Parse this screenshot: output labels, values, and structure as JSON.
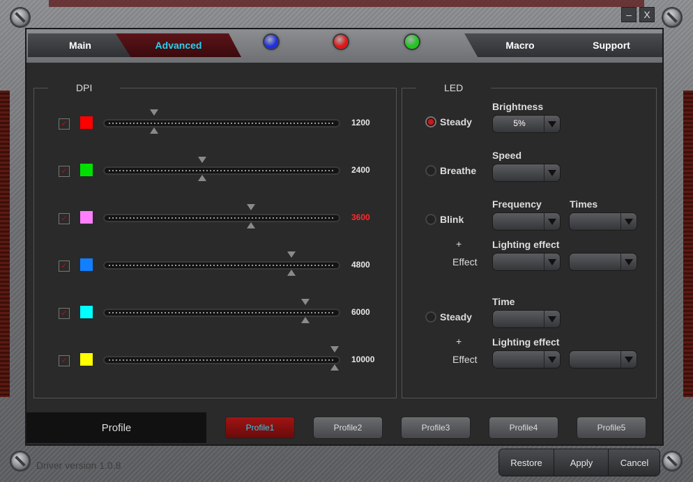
{
  "tabs": {
    "main": "Main",
    "advanced": "Advanced",
    "macro": "Macro",
    "support": "Support"
  },
  "window": {
    "minimize": "–",
    "close": "X"
  },
  "indicators": [
    {
      "color": "#1e2fe0"
    },
    {
      "color": "#e01616"
    },
    {
      "color": "#1ec81e"
    }
  ],
  "dpi": {
    "legend": "DPI",
    "rows": [
      {
        "checked": true,
        "color": "#ff0000",
        "value": "1200",
        "fraction": 0.2,
        "value_color": "#e8e8e8"
      },
      {
        "checked": true,
        "color": "#00e000",
        "value": "2400",
        "fraction": 0.415,
        "value_color": "#e8e8e8"
      },
      {
        "checked": true,
        "color": "#ff80ff",
        "value": "3600",
        "fraction": 0.63,
        "value_color": "#ff2a2a"
      },
      {
        "checked": true,
        "color": "#1080ff",
        "value": "4800",
        "fraction": 0.81,
        "value_color": "#e8e8e8"
      },
      {
        "checked": true,
        "color": "#00ffff",
        "value": "6000",
        "fraction": 0.87,
        "value_color": "#e8e8e8"
      },
      {
        "checked": true,
        "color": "#ffff00",
        "value": "10000",
        "fraction": 1.0,
        "value_color": "#e8e8e8"
      }
    ]
  },
  "led": {
    "legend": "LED",
    "steady": {
      "label": "Steady",
      "selected": true,
      "brightness_label": "Brightness",
      "brightness_value": "5%"
    },
    "breathe": {
      "label": "Breathe",
      "selected": false,
      "speed_label": "Speed",
      "speed_value": ""
    },
    "blink": {
      "label": "Blink",
      "selected": false,
      "frequency_label": "Frequency",
      "times_label": "Times",
      "plus": "+",
      "effect_label": "Effect",
      "lighting_label": "Lighting effect"
    },
    "steady2": {
      "label": "Steady",
      "selected": false,
      "time_label": "Time",
      "plus": "+",
      "effect_label": "Effect",
      "lighting_label": "Lighting effect"
    }
  },
  "profile": {
    "label": "Profile",
    "buttons": [
      "Profile1",
      "Profile2",
      "Profile3",
      "Profile4",
      "Profile5"
    ],
    "active_index": 0
  },
  "footer": {
    "version": "Driver version  1.0.8",
    "restore": "Restore",
    "apply": "Apply",
    "cancel": "Cancel"
  }
}
